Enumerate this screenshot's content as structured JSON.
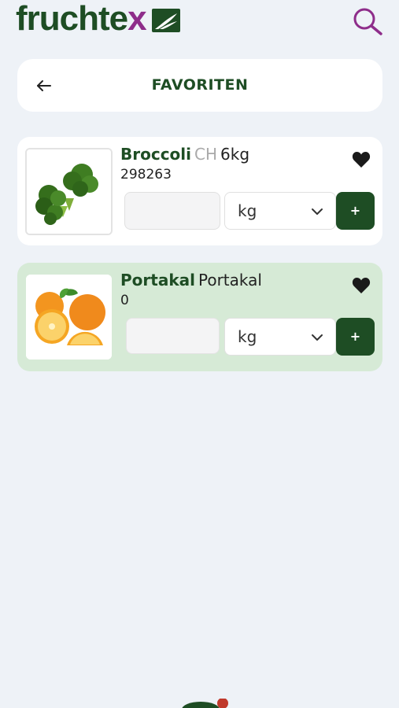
{
  "app": {
    "logo_part1": "fruchte",
    "logo_part2": "x"
  },
  "colors": {
    "brand_green": "#1e4d24",
    "brand_purple": "#8e2d8a",
    "page_background": "#eef2f7",
    "highlight_card": "#d6ead6"
  },
  "icons": {
    "search": "search-icon",
    "back": "arrow-left-icon",
    "favorite": "heart-icon",
    "dropdown": "chevron-down-icon"
  },
  "header": {
    "title": "FAVORITEN"
  },
  "favorites": [
    {
      "name": "Broccoli",
      "origin": "CH",
      "size": "6kg",
      "code": "298263",
      "quantity": "",
      "unit": "kg",
      "add_label": "+"
    },
    {
      "name": "Portakal",
      "origin": "",
      "size": "Portakal",
      "code": "0",
      "quantity": "",
      "unit": "kg",
      "add_label": "+"
    }
  ]
}
